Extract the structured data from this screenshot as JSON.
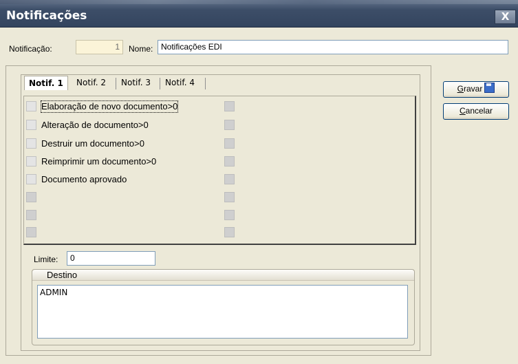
{
  "window": {
    "title": "Notificações",
    "close_label": "X"
  },
  "form": {
    "notificacao_label": "Notificação:",
    "notificacao_value": "1",
    "nome_label": "Nome:",
    "nome_value": "Notificações EDI"
  },
  "tabs": [
    {
      "label": "Notif. 1",
      "active": true
    },
    {
      "label": "Notif. 2",
      "active": false
    },
    {
      "label": "Notif. 3",
      "active": false
    },
    {
      "label": "Notif. 4",
      "active": false
    }
  ],
  "checklist": [
    {
      "label": "Elaboração de novo documento>0",
      "checked": false
    },
    {
      "label": "Alteração de documento>0",
      "checked": false
    },
    {
      "label": "Destruir um documento>0",
      "checked": false
    },
    {
      "label": "Reimprimir um documento>0",
      "checked": false
    },
    {
      "label": "Documento aprovado",
      "checked": false
    }
  ],
  "limite": {
    "label": "Limite:",
    "value": "0"
  },
  "destino": {
    "title": "Destino",
    "value": "ADMIN"
  },
  "buttons": {
    "save_label": "Gravar",
    "save_accel": "G",
    "cancel_label": "Cancelar",
    "cancel_accel": "C"
  }
}
